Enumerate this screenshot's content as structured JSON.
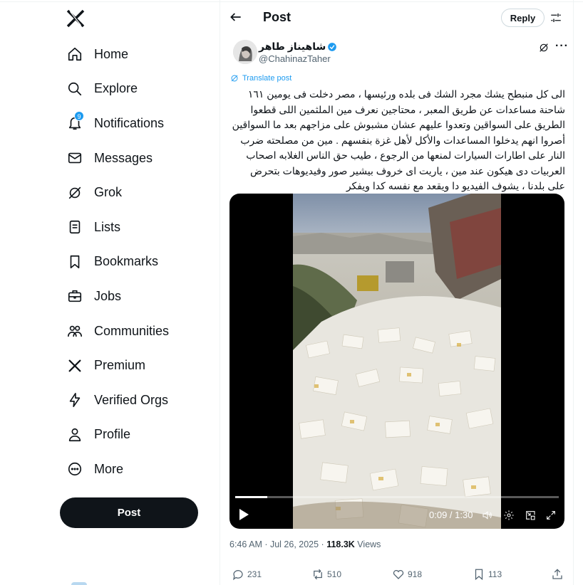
{
  "sidebar": {
    "logo": "X",
    "nav": [
      {
        "label": "Home",
        "icon": "home-icon"
      },
      {
        "label": "Explore",
        "icon": "search-icon"
      },
      {
        "label": "Notifications",
        "icon": "bell-icon",
        "badge": "9"
      },
      {
        "label": "Messages",
        "icon": "envelope-icon"
      },
      {
        "label": "Grok",
        "icon": "grok-icon"
      },
      {
        "label": "Lists",
        "icon": "list-icon"
      },
      {
        "label": "Bookmarks",
        "icon": "bookmark-icon"
      },
      {
        "label": "Jobs",
        "icon": "briefcase-icon"
      },
      {
        "label": "Communities",
        "icon": "communities-icon"
      },
      {
        "label": "Premium",
        "icon": "x-logo-icon"
      },
      {
        "label": "Verified Orgs",
        "icon": "lightning-icon"
      },
      {
        "label": "Profile",
        "icon": "person-icon"
      },
      {
        "label": "More",
        "icon": "more-circle-icon"
      }
    ],
    "post_button": "Post"
  },
  "header": {
    "title": "Post",
    "reply_button": "Reply"
  },
  "post": {
    "author_name": "شاهيناز طاهر",
    "handle": "@ChahinazTaher",
    "translate_label": "Translate post",
    "text": "الى كل منبطح يشك مجرد الشك فى بلده ورئيسها ،  مصر دخلت فى يومين ١٦١ شاحنة مساعدات عن طريق المعبر ، محتاجين نعرف مين الملثمين اللى قطعوا الطريق على السواقين وتعدوا عليهم عشان مشبوش على مزاجهم بعد ما السواقين أصروا انهم يدخلوا المساعدات والأكل لأهل غزة بنفسهم .  مين من مصلحته ضرب النار على اطارات السيارات لمنعها من الرجوع ، طيب حق الناس الغلابه اصحاب العربيات دى هيكون عند مين ، ياريت اى خروف بيشير صور وفيديوهات بتحرض على بلدنا ، يشوف الفيديو دا ويقعد مع نفسه كدا ويفكر",
    "video": {
      "time": "0:09 / 1:30",
      "progress": 0.1
    },
    "timestamp": "6:46 AM · Jul 26, 2025 · ",
    "views_count": "118.3K",
    "views_label": " Views",
    "stats": {
      "replies": "231",
      "reposts": "510",
      "likes": "918",
      "bookmarks": "113"
    }
  },
  "colors": {
    "accent": "#1d9bf0",
    "text": "#0f1419",
    "muted": "#536471"
  }
}
